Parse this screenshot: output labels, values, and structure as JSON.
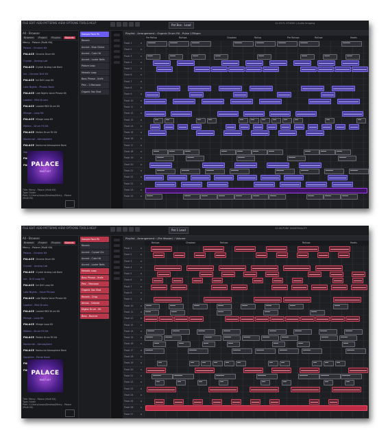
{
  "shot1": {
    "menu": "FILE EDIT ADD PATTERNS VIEW OPTIONS TOOLS HELP",
    "pattern_selector": "Pat Box - Lead",
    "hint": "12:03 FL STUDIO | Audio Imaging",
    "browser_title": "All - Browser",
    "browser_controls": [
      "Browser",
      "Project",
      "Plugins",
      "Sounds"
    ],
    "browser_path": "Mercy - Palace (Multi Kit)",
    "packs": [
      {
        "folder": "Palace - Chrome Kit",
        "name": "Chrome Drum Kit"
      },
      {
        "folder": "Crystal - Analog Lab",
        "name": "Crystal Analog Lab Bank"
      },
      {
        "folder": "Ice - Chrome Drill Kit",
        "name": "Ice Drill Loop Kit"
      },
      {
        "folder": "Late Nights - Phrase Bank",
        "name": "Late Nights Vocal Phrase Kit"
      },
      {
        "folder": "Loaded - Midi Drums",
        "name": "Loaded MIDI Drum Kit"
      },
      {
        "folder": "Mirage - Loop Kit",
        "name": "Mirage Loop Kit"
      },
      {
        "folder": "Molten - Drum Fill Kit",
        "name": "Molten Drum Fill Kit"
      },
      {
        "folder": "Nocturnal - Atmosphere",
        "name": "Nocturnal Atmosphere Bank"
      },
      {
        "folder": "Sapphire - Portal",
        "name": "Sapphire Portal Bank"
      },
      {
        "folder": "Velvet - Accent Kit",
        "name": "Velvet Accent Kit"
      },
      {
        "folder": "Vitura - Art",
        "name": "Vitura"
      }
    ],
    "art_title": "PALACE",
    "art_subtitle": "MULTI KIT",
    "info": [
      "Title: Mercy - Palace (Multi Kit)",
      "Type: Folder",
      "Path: C:/Users/Loops/Desktop/Mercy - Palace (Multi Kit)"
    ],
    "channels": [
      "Sample Pack Pk",
      "Reverb",
      "Accent - Blue Chime",
      "Accent - Cute Hit",
      "Accent - Luster Bells",
      "Palace Loop",
      "Melodic Loop",
      "Bass Phrase - Knife",
      "Perc - 1 Monsoon",
      "Organic Vox Shot"
    ],
    "selected_channel": 0,
    "playlist_title": "Playlist - Arrangement › Organic Drum Fill - Pulse 135bpm",
    "ruler": [
      "Pre Rollup",
      "Rollups",
      "Chopbox",
      "Rollup",
      "Pre Rollups",
      "Rollups",
      "Hooks"
    ],
    "tracks": [
      "Track 1",
      "Track 2",
      "Track 3",
      "Track 4",
      "Track 5",
      "Track 6",
      "Track 7",
      "Track 8",
      "Track 9",
      "Track 10",
      "Track 11",
      "Track 12",
      "Track 13",
      "Track 14",
      "Track 15",
      "Track 16",
      "Track 17",
      "Track 18",
      "Track 19",
      "Track 20",
      "Track 21",
      "Track 22",
      "Track 23",
      "Track 24",
      "Track 25"
    ]
  },
  "shot2": {
    "menu": "FILE EDIT ADD PATTERNS VIEW OPTIONS TOOLS HELP",
    "pattern_selector": "Pat 1 Lead",
    "hint": "12:06 PURE UNIVERSALITY",
    "browser_title": "All - Browser",
    "browser_controls": [
      "Browser",
      "Project",
      "Plugins",
      "Sounds"
    ],
    "browser_path": "Mercy - Palace (Multi Kit)",
    "packs": [
      {
        "folder": "Palace - Chrome Kit",
        "name": "Chrome Drum Kit"
      },
      {
        "folder": "Crystal - Analog Lab",
        "name": "Crystal Analog Lab Bank"
      },
      {
        "folder": "Ice - Drill Loop Kit",
        "name": "Ice Drill Loop Kit"
      },
      {
        "folder": "Late Nights - Vocal Phrase",
        "name": "Late Nights Vocal Phrase Kit"
      },
      {
        "folder": "Loaded - Midi Drums",
        "name": "Loaded MIDI Drum Kit"
      },
      {
        "folder": "Mirage - Loop Kit",
        "name": "Mirage Loop Kit"
      },
      {
        "folder": "Molten - Drum Fill Kit",
        "name": "Molten Drum Fill Kit"
      },
      {
        "folder": "Nocturnal - Atmosphere",
        "name": "Nocturnal Atmosphere Bank"
      },
      {
        "folder": "Sapphire - Portal Bank",
        "name": "Sapphire Portal Bank"
      },
      {
        "folder": "Velvet - Accent Kit",
        "name": "Velvet Accent Kit"
      },
      {
        "folder": "Vitura - Art",
        "name": "Vitura"
      }
    ],
    "art_title": "PALACE",
    "art_subtitle": "MULTI KIT",
    "info": [
      "Title: Mercy - Palace (Multi Kit)",
      "Type: Folder",
      "Path: C:/Users/Loops/Desktop/Mercy - Palace (Multi Kit)"
    ],
    "channels": [
      "Sample Pack Pk",
      "Reverb",
      "Accent - Crystal Chi",
      "Accent - Cute Hit",
      "Accent - Luster Bells",
      "Melodic Loop",
      "Bass Phrase - Knife",
      "Perc - Monsoon",
      "Organic Vox Shot",
      "Reverb - Crisp",
      "Atmos - Celeste",
      "Digital Drum - Kit",
      "Bass - Bounce"
    ],
    "selected_channel": 0,
    "playlist_title": "Playlist - Arrangement › (Pre Master) › Volume",
    "ruler": [
      "Rollups",
      "Chopbox",
      "Rollups",
      "Rollups",
      "Hooks"
    ],
    "tracks": [
      "Track 1",
      "Track 2",
      "Track 3",
      "Track 4",
      "Track 5",
      "Track 6",
      "Track 7",
      "Track 8",
      "Track 9",
      "Track 10",
      "Track 11",
      "Track 12",
      "Track 13",
      "Track 14",
      "Track 15",
      "Track 16",
      "Track 17",
      "Track 18",
      "Track 19",
      "Track 20",
      "Track 21",
      "Track 22",
      "Track 23",
      "Track 24",
      "Track 25",
      "Track 26",
      "Track 27"
    ]
  },
  "colors": {
    "accent_purple": "#6a5df2",
    "accent_red": "#c23a4f",
    "automation_purple": "#a13ff2",
    "automation_red": "#ff4d69",
    "background": "#141416"
  }
}
